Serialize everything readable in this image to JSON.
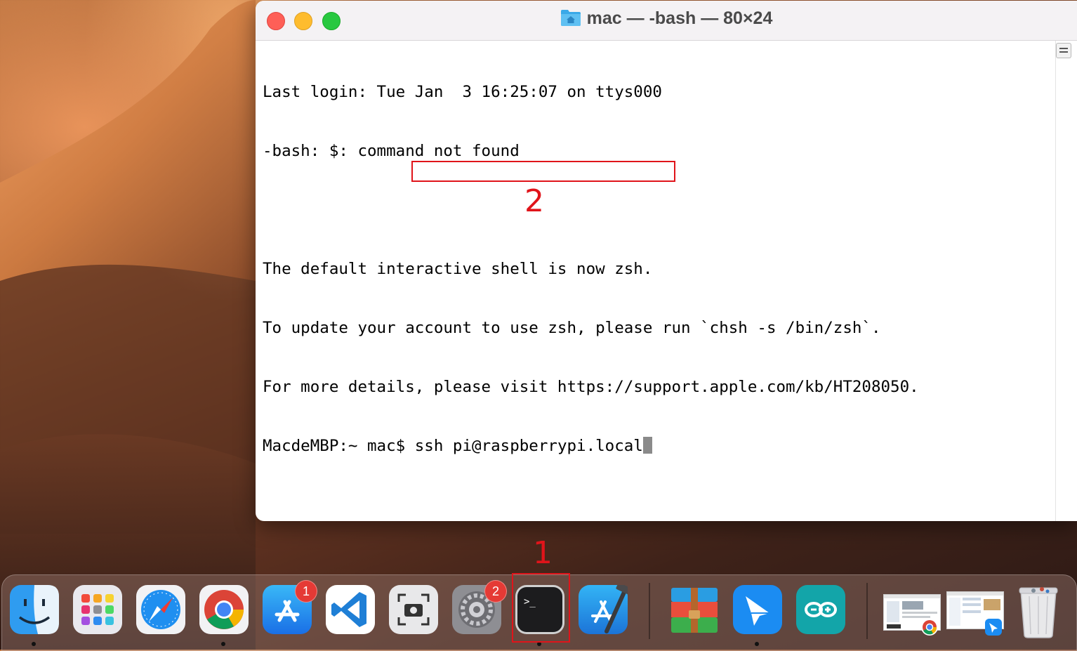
{
  "window": {
    "title": "mac — -bash — 80×24",
    "folder_icon": "home-folder-icon"
  },
  "terminal": {
    "lines": [
      "Last login: Tue Jan  3 16:25:07 on ttys000",
      "-bash: $: command not found",
      "",
      "The default interactive shell is now zsh.",
      "To update your account to use zsh, please run `chsh -s /bin/zsh`.",
      "For more details, please visit https://support.apple.com/kb/HT208050."
    ],
    "prompt": "MacdeMBP:~ mac$ ",
    "command": "ssh pi@raspberrypi.local"
  },
  "annotations": {
    "step1": "1",
    "step2": "2",
    "color": "#e0141a"
  },
  "dock": {
    "apps": [
      {
        "name": "Finder",
        "icon": "finder-icon",
        "running": true
      },
      {
        "name": "Launchpad",
        "icon": "launchpad-icon",
        "running": false
      },
      {
        "name": "Safari",
        "icon": "safari-icon",
        "running": false
      },
      {
        "name": "Google Chrome",
        "icon": "chrome-icon",
        "running": true
      },
      {
        "name": "App Store",
        "icon": "app-store-icon",
        "running": false,
        "badge": "1"
      },
      {
        "name": "Visual Studio Code",
        "icon": "vscode-icon",
        "running": false
      },
      {
        "name": "Screenshot",
        "icon": "screenshot-icon",
        "running": false
      },
      {
        "name": "System Preferences",
        "icon": "system-preferences-icon",
        "running": false,
        "badge": "2"
      },
      {
        "name": "Terminal",
        "icon": "terminal-icon",
        "running": true
      },
      {
        "name": "Xcode",
        "icon": "xcode-icon",
        "running": false
      },
      {
        "name": "Archiver",
        "icon": "archive-icon",
        "running": false
      },
      {
        "name": "Feishu",
        "icon": "feishu-icon",
        "running": true
      },
      {
        "name": "Arduino",
        "icon": "arduino-icon",
        "running": false
      },
      {
        "name": "Chrome window",
        "icon": "chrome-window-thumbnail",
        "running": false
      },
      {
        "name": "Feishu window",
        "icon": "feishu-window-thumbnail",
        "running": false
      },
      {
        "name": "Trash",
        "icon": "trash-icon",
        "running": false
      }
    ]
  }
}
